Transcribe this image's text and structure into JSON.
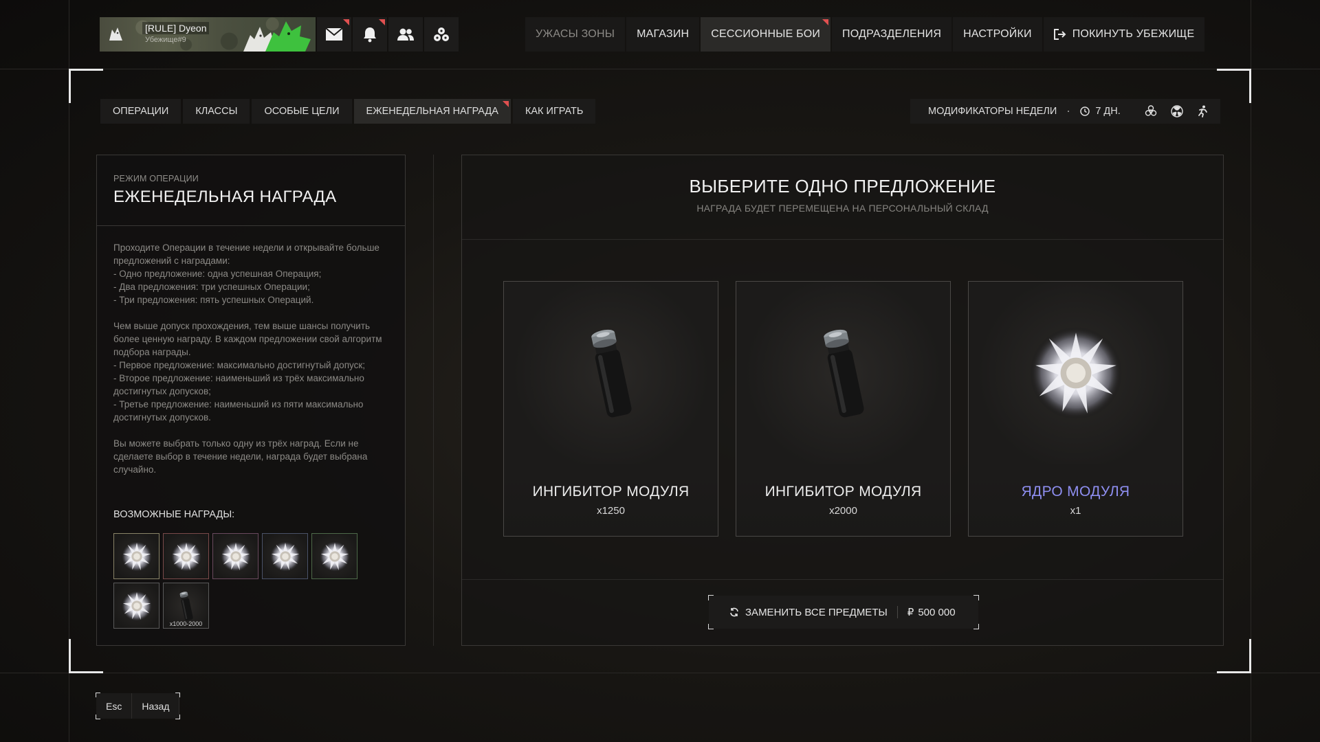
{
  "profile": {
    "name": "[RULE] Dyeon",
    "shelter": "Убежище#9"
  },
  "top_nav": [
    {
      "label": "УЖАСЫ ЗОНЫ"
    },
    {
      "label": "МАГАЗИН"
    },
    {
      "label": "СЕССИОННЫЕ БОИ"
    },
    {
      "label": "ПОДРАЗДЕЛЕНИЯ"
    },
    {
      "label": "НАСТРОЙКИ"
    },
    {
      "label": "ПОКИНУТЬ УБЕЖИЩЕ"
    }
  ],
  "sub_tabs": [
    {
      "label": "ОПЕРАЦИИ"
    },
    {
      "label": "КЛАССЫ"
    },
    {
      "label": "ОСОБЫЕ ЦЕЛИ"
    },
    {
      "label": "ЕЖЕНЕДЕЛЬНАЯ НАГРАДА"
    },
    {
      "label": "КАК ИГРАТЬ"
    }
  ],
  "modifiers": {
    "label": "МОДИФИКАТОРЫ НЕДЕЛИ",
    "time": "7 ДН."
  },
  "left_panel": {
    "mode": "РЕЖИМ ОПЕРАЦИИ",
    "title": "ЕЖЕНЕДЕЛЬНАЯ НАГРАДА",
    "para1": "Проходите Операции в течение недели и открывайте больше предложений с наградами:\n- Одно предложение: одна успешная Операция;\n- Два предложения: три успешных Операции;\n- Три предложения: пять успешных Операций.",
    "para2": "Чем выше допуск прохождения, тем выше шансы получить более ценную награду. В каждом предложении свой алгоритм подбора награды.\n- Первое предложение: максимально достигнутый допуск;\n- Второе предложение: наименьший из трёх максимально достигнутых допусков;\n- Третье предложение: наименьший из пяти максимально достигнутых допусков.",
    "para3": "Вы можете выбрать только одну из трёх наград. Если не сделаете выбор в течение недели, награда будет выбрана случайно.",
    "possible_label": "ВОЗМОЖНЫЕ НАГРАДЫ:",
    "rewards": [
      {
        "icon": "module-core",
        "border": "#8a8468",
        "qty": ""
      },
      {
        "icon": "module-core",
        "border": "#7a4a4a",
        "qty": ""
      },
      {
        "icon": "module-core",
        "border": "#6a4a5e",
        "qty": ""
      },
      {
        "icon": "module-core",
        "border": "#4a5268",
        "qty": ""
      },
      {
        "icon": "module-core",
        "border": "#4e6a4a",
        "qty": ""
      },
      {
        "icon": "module-core",
        "border": "#5a5a5a",
        "qty": ""
      },
      {
        "icon": "module-inhibitor",
        "border": "#5a5a5a",
        "qty": "x1000-2000"
      }
    ]
  },
  "offers": {
    "title": "ВЫБЕРИТЕ ОДНО ПРЕДЛОЖЕНИЕ",
    "subtitle": "НАГРАДА БУДЕТ ПЕРЕМЕЩЕНА НА ПЕРСОНАЛЬНЫЙ СКЛАД",
    "cards": [
      {
        "name": "ИНГИБИТОР МОДУЛЯ",
        "qty": "x1250",
        "icon": "module-inhibitor"
      },
      {
        "name": "ИНГИБИТОР МОДУЛЯ",
        "qty": "x2000",
        "icon": "module-inhibitor"
      },
      {
        "name": "ЯДРО МОДУЛЯ",
        "qty": "x1",
        "icon": "module-core",
        "name_color": "#8e8ef0"
      }
    ],
    "replace_label": "ЗАМЕНИТЬ ВСЕ ПРЕДМЕТЫ",
    "replace_price": "500 000"
  },
  "footer": {
    "esc_key": "Esc",
    "back_label": "Назад"
  }
}
